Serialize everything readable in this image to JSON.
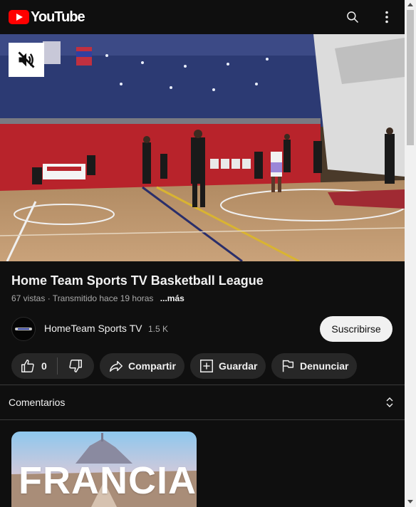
{
  "header": {
    "logo_text": "YouTube",
    "search_icon": "search-icon",
    "more_icon": "more-vert-icon"
  },
  "player": {
    "mute_icon": "volume-off-icon"
  },
  "video": {
    "title": "Home Team Sports TV Basketball League",
    "meta": "67 vistas · Transmitido hace 19 horas",
    "more_label": "...más"
  },
  "channel": {
    "name": "HomeTeam Sports TV",
    "subscribers": "1.5 K",
    "subscribe_label": "Suscribirse"
  },
  "actions": {
    "like_count": "0",
    "share_label": "Compartir",
    "save_label": "Guardar",
    "report_label": "Denunciar"
  },
  "comments": {
    "label": "Comentarios"
  },
  "recommended": {
    "thumbnail_text": "FRANCIA"
  },
  "colors": {
    "background": "#0f0f0f",
    "pill": "#272727",
    "brand_red": "#ff0000",
    "subscribe_bg": "#f1f1f1",
    "muted_text": "#aaaaaa"
  }
}
